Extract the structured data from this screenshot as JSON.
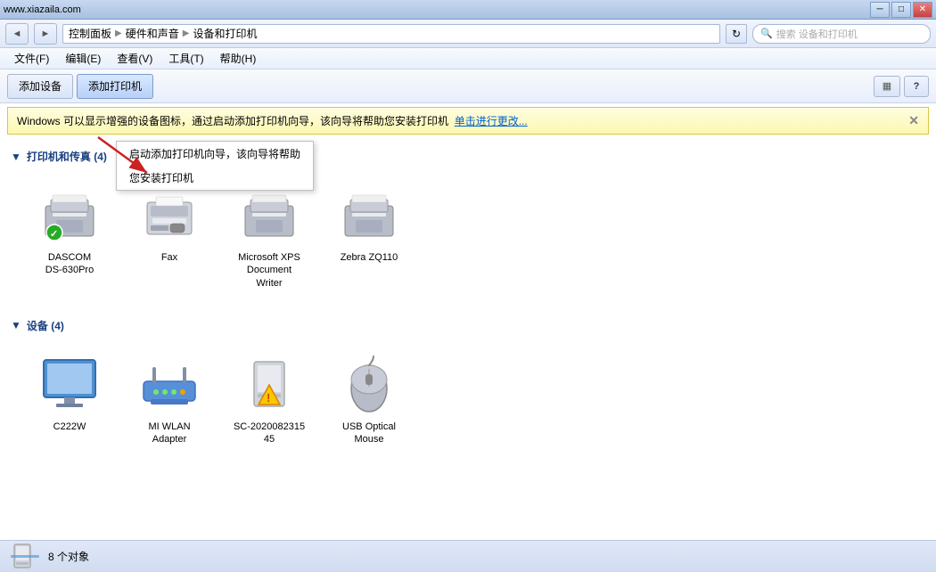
{
  "window": {
    "title": "www.xiazaila.com",
    "title_btn_min": "─",
    "title_btn_max": "□",
    "title_btn_close": "✕"
  },
  "address_bar": {
    "back_label": "◄",
    "forward_label": "►",
    "path": [
      "控制面板",
      "硬件和声音",
      "设备和打印机"
    ],
    "refresh_label": "↻",
    "search_placeholder": "搜索 设备和打印机",
    "search_icon": "🔍"
  },
  "menu": {
    "items": [
      {
        "label": "文件(F)"
      },
      {
        "label": "编辑(E)"
      },
      {
        "label": "查看(V)"
      },
      {
        "label": "工具(T)"
      },
      {
        "label": "帮助(H)"
      }
    ]
  },
  "toolbar": {
    "add_device_label": "添加设备",
    "add_printer_label": "添加打印机",
    "view_icon": "▦",
    "help_icon": "?"
  },
  "notification": {
    "text": "Windows 可以显示增强的设备图标，通过启动添加打印机向导，该向导将帮助您安装打印机",
    "link_text": "单击进行更改...",
    "close": "✕"
  },
  "tooltip_menu": {
    "items": [
      {
        "label": "启动添加打印机向导，该向导将帮助"
      },
      {
        "label": "您安装打印机"
      }
    ]
  },
  "printers_section": {
    "title": "打印机和传真 (4)",
    "devices": [
      {
        "name": "DASCOM\nDS-630Pro",
        "type": "printer",
        "has_check": true
      },
      {
        "name": "Fax",
        "type": "fax",
        "has_check": false
      },
      {
        "name": "Microsoft XPS\nDocument\nWriter",
        "type": "printer",
        "has_check": false
      },
      {
        "name": "Zebra ZQ110",
        "type": "printer",
        "has_check": false
      }
    ]
  },
  "devices_section": {
    "title": "设备 (4)",
    "devices": [
      {
        "name": "C222W",
        "type": "monitor"
      },
      {
        "name": "MI WLAN\nAdapter",
        "type": "router"
      },
      {
        "name": "SC-2020082315\n45",
        "type": "scanner_warning"
      },
      {
        "name": "USB Optical\nMouse",
        "type": "mouse"
      }
    ]
  },
  "status_bar": {
    "count_text": "8 个对象",
    "icon_type": "scanner"
  }
}
